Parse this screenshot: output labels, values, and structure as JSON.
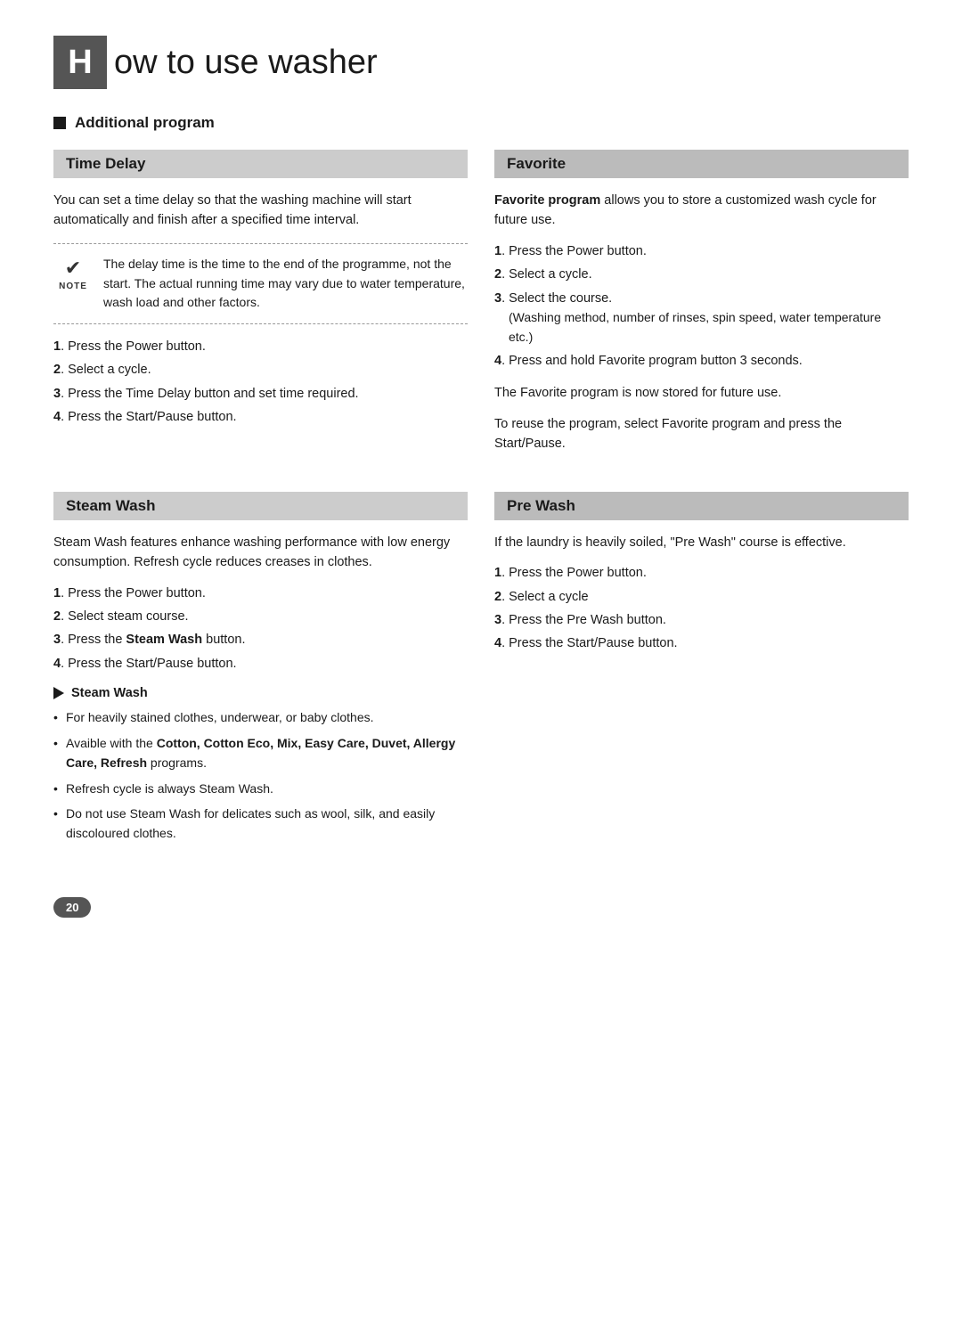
{
  "header": {
    "letter": "H",
    "title": "ow to use washer"
  },
  "section": {
    "label": "Additional program"
  },
  "time_delay": {
    "card_title": "Time Delay",
    "intro": "You can set a time delay so that the washing machine will start automatically and finish after a specified time interval.",
    "note": {
      "text": "The delay time is the time to the end of the programme, not the start. The actual running time may vary due to water temperature, wash load and other factors."
    },
    "steps": [
      {
        "num": "1",
        "text": "Press the Power button.",
        "sub": null
      },
      {
        "num": "2",
        "text": "Select a cycle.",
        "sub": null
      },
      {
        "num": "3",
        "text": "Press the Time Delay button and set time required.",
        "sub": null
      },
      {
        "num": "4",
        "text": "Press the Start/Pause button.",
        "sub": null
      }
    ]
  },
  "favorite": {
    "card_title": "Favorite",
    "intro_bold": "Favorite program",
    "intro_rest": " allows you to store a customized wash cycle for future use.",
    "steps": [
      {
        "num": "1",
        "text": "Press the Power button.",
        "sub": null
      },
      {
        "num": "2",
        "text": "Select a cycle.",
        "sub": null
      },
      {
        "num": "3",
        "text": "Select the course.",
        "sub": "(Washing method, number of rinses, spin speed, water temperature etc.)"
      },
      {
        "num": "4",
        "text": "Press and hold Favorite program button 3 seconds.",
        "sub": null
      }
    ],
    "stored_text": "The Favorite program is now stored for future use.",
    "reuse_text": "To reuse the program, select Favorite program and press the Start/Pause."
  },
  "steam_wash": {
    "card_title": "Steam Wash",
    "intro": "Steam Wash features enhance washing performance with low energy consumption. Refresh cycle reduces creases in clothes.",
    "steps": [
      {
        "num": "1",
        "text": "Press the Power button.",
        "sub": null
      },
      {
        "num": "2",
        "text": "Select steam course.",
        "sub": null
      },
      {
        "num": "3",
        "text": "Press the ",
        "bold": "Steam Wash",
        "rest": " button.",
        "sub": null
      },
      {
        "num": "4",
        "text": "Press the Start/Pause button.",
        "sub": null
      }
    ],
    "sub_title": "Steam Wash",
    "bullets": [
      {
        "text": "For heavily stained clothes, underwear, or baby clothes."
      },
      {
        "text_parts": [
          {
            "t": "Avaible with the "
          },
          {
            "t": "Cotton, Cotton Eco, Mix, Easy Care, Duvet, Allergy Care, Refresh",
            "b": true
          },
          {
            "t": " programs."
          }
        ]
      },
      {
        "text": "Refresh cycle is always Steam Wash."
      },
      {
        "text": "Do not use Steam Wash for delicates such as wool, silk, and easily discoloured clothes."
      }
    ]
  },
  "pre_wash": {
    "card_title": "Pre Wash",
    "intro": "If the laundry is heavily soiled, \"Pre Wash\" course is effective.",
    "steps": [
      {
        "num": "1",
        "text": "Press the Power button.",
        "sub": null
      },
      {
        "num": "2",
        "text": "Select a cycle",
        "sub": null
      },
      {
        "num": "3",
        "text": "Press the Pre Wash button.",
        "sub": null
      },
      {
        "num": "4",
        "text": "Press the Start/Pause button.",
        "sub": null
      }
    ]
  },
  "page_number": "20"
}
